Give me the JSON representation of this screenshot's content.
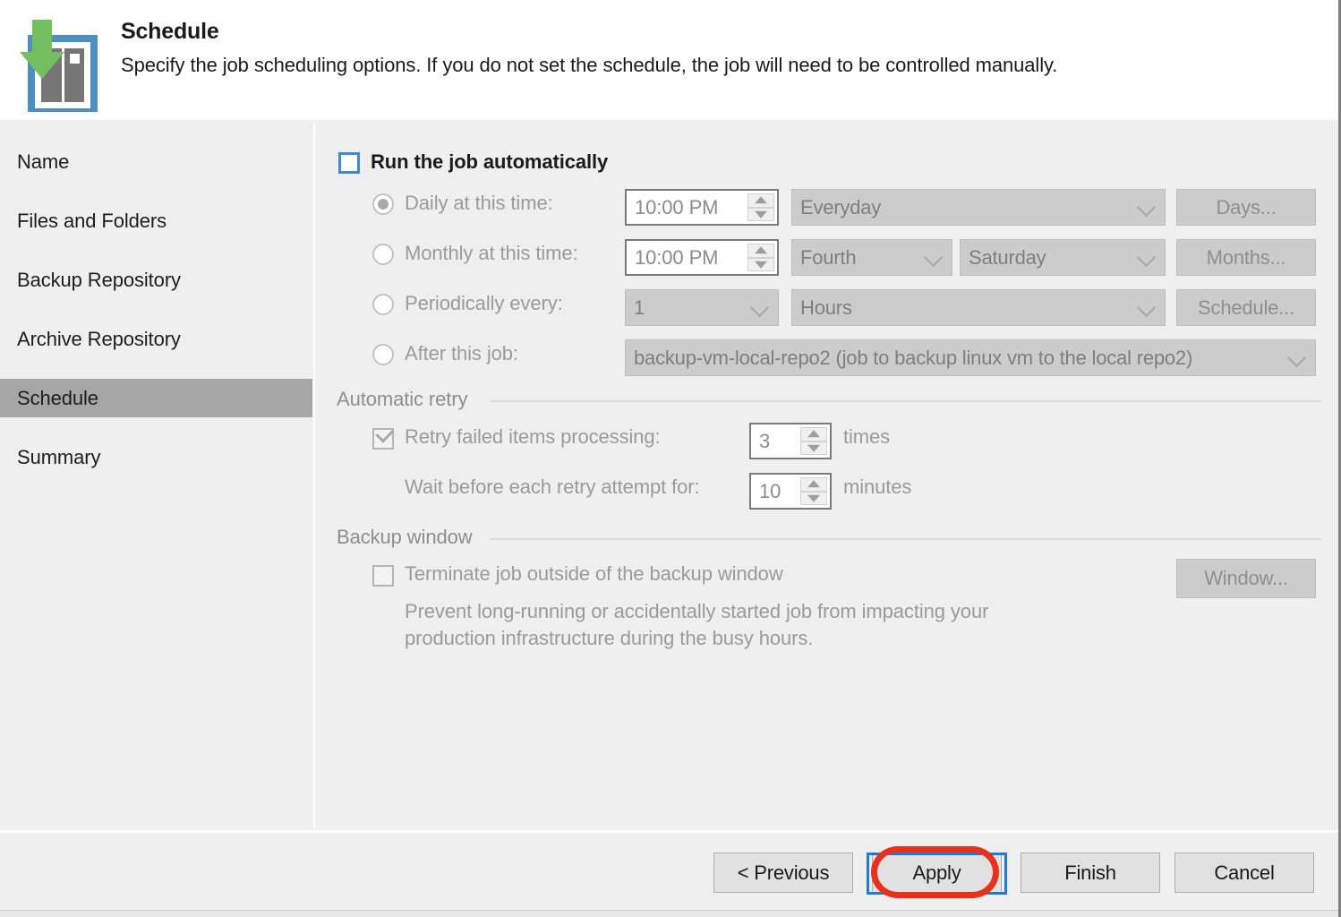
{
  "header": {
    "title": "Schedule",
    "subtitle": "Specify the job scheduling options. If you do not set the schedule, the job will need to be controlled manually.",
    "icon": "backup-schedule-icon"
  },
  "sidebar": {
    "items": [
      {
        "label": "Name",
        "selected": false
      },
      {
        "label": "Files and Folders",
        "selected": false
      },
      {
        "label": "Backup Repository",
        "selected": false
      },
      {
        "label": "Archive Repository",
        "selected": false
      },
      {
        "label": "Schedule",
        "selected": true
      },
      {
        "label": "Summary",
        "selected": false
      }
    ]
  },
  "main": {
    "run_automatically": {
      "label": "Run the job automatically",
      "checked": false
    },
    "daily": {
      "label": "Daily at this time:",
      "selected": true,
      "time": "10:00 PM",
      "frequency": "Everyday",
      "button": "Days..."
    },
    "monthly": {
      "label": "Monthly at this time:",
      "selected": false,
      "time": "10:00 PM",
      "week": "Fourth",
      "day": "Saturday",
      "button": "Months..."
    },
    "periodically": {
      "label": "Periodically every:",
      "selected": false,
      "interval": "1",
      "unit": "Hours",
      "button": "Schedule..."
    },
    "after_job": {
      "label": "After this job:",
      "selected": false,
      "job": "backup-vm-local-repo2 (job to backup linux vm to the local repo2)"
    },
    "automatic_retry": {
      "group_label": "Automatic retry",
      "retry_label": "Retry failed items processing:",
      "retry_checked": true,
      "retry_times": "3",
      "retry_times_unit": "times",
      "wait_label": "Wait before each retry attempt for:",
      "wait_minutes": "10",
      "wait_unit": "minutes"
    },
    "backup_window": {
      "group_label": "Backup window",
      "terminate_label": "Terminate job outside of the backup window",
      "terminate_checked": false,
      "window_button": "Window...",
      "description_line1": "Prevent long-running or accidentally started job from impacting your",
      "description_line2": "production infrastructure during the busy hours."
    }
  },
  "footer": {
    "previous": "< Previous",
    "apply": "Apply",
    "finish": "Finish",
    "cancel": "Cancel"
  },
  "colors": {
    "accent_blue": "#3d8ad8",
    "focus_blue": "#1d7ad6",
    "annotation_red": "#e8311a",
    "selected_nav": "#a6a6a6",
    "icon_green": "#73bf60",
    "icon_blue": "#4a90c4",
    "icon_gray": "#757575"
  }
}
